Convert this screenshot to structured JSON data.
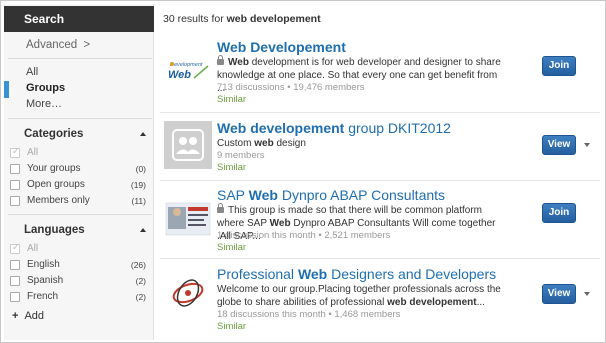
{
  "sidebar": {
    "search_label": "Search",
    "advanced_label": "Advanced",
    "advanced_chevron": ">",
    "scope": [
      "All",
      "Groups",
      "More…"
    ],
    "categories": {
      "title": "Categories",
      "items": [
        {
          "label": "All",
          "count": ""
        },
        {
          "label": "Your groups",
          "count": "(0)"
        },
        {
          "label": "Open groups",
          "count": "(19)"
        },
        {
          "label": "Members only",
          "count": "(11)"
        }
      ]
    },
    "languages": {
      "title": "Languages",
      "items": [
        {
          "label": "All",
          "count": ""
        },
        {
          "label": "English",
          "count": "(26)"
        },
        {
          "label": "Spanish",
          "count": "(2)"
        },
        {
          "label": "French",
          "count": "(2)"
        }
      ]
    },
    "add_plus": "+",
    "add_label": "Add"
  },
  "results": {
    "count_text": "30 results for",
    "query": "web developement",
    "items": [
      {
        "title_strong": "Web Developement",
        "title_rest": "",
        "thumb_logo_top": "Development",
        "thumb_logo_bottom": "Web",
        "desc_pre": "",
        "desc_strong1": "Web",
        "desc_mid": " development is for web developer and designer to share knowledge at one place. So that every one can get benefit from ...",
        "desc_strong2": "",
        "desc_post": "",
        "meta": "713 discussions • 19,476 members",
        "similar": "Similar",
        "action": "Join"
      },
      {
        "title_strong": "Web developement",
        "title_rest": " group DKIT2012",
        "desc_pre": "Custom ",
        "desc_strong1": "web",
        "desc_mid": " design",
        "desc_strong2": "",
        "desc_post": "",
        "meta": "9 members",
        "similar": "Similar",
        "action": "View"
      },
      {
        "title_pre": "SAP ",
        "title_strong": "Web",
        "title_rest": " Dynpro ABAP Consultants",
        "desc_pre": "This group is made so that there will be common platform where SAP ",
        "desc_strong1": "Web",
        "desc_mid": " Dynpro ABAP Consultants Will come together .All SAP...",
        "desc_strong2": "",
        "desc_post": "",
        "meta": "1 discussion this month • 2,521 members",
        "similar": "Similar",
        "action": "Join"
      },
      {
        "title_pre": "Professional ",
        "title_strong": "Web",
        "title_rest": " Designers and Developers",
        "desc_pre": "Welcome to our group.Placing together professionals across the globe to share abilities of professional ",
        "desc_strong1": "web developement",
        "desc_mid": "...",
        "desc_strong2": "",
        "desc_post": "",
        "meta": "18 discussions this month • 1,468 members",
        "similar": "Similar",
        "action": "View"
      }
    ]
  },
  "colors": {
    "link": "#1f6fb0",
    "button": "#2d6aa9",
    "similar": "#6a9e3c",
    "scope_accent": "#3a91d4",
    "search_bg": "#333333"
  }
}
